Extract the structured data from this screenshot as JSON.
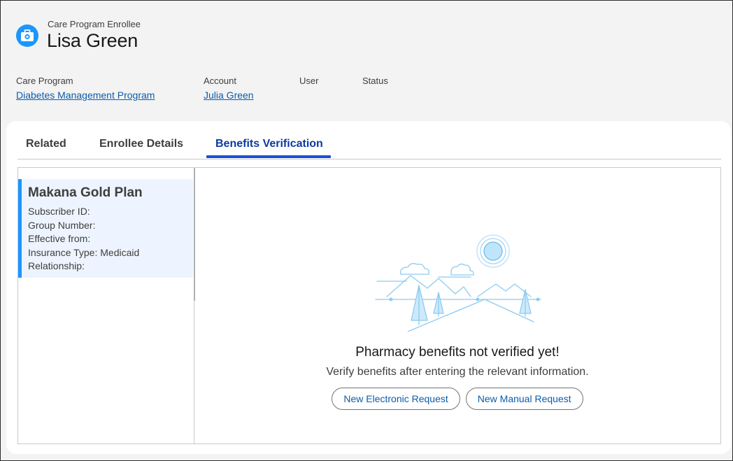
{
  "header": {
    "object_type": "Care Program Enrollee",
    "record_name": "Lisa Green",
    "icon": "briefcase-medical-icon",
    "icon_color": "#1b96ff"
  },
  "highlights": [
    {
      "label": "Care Program",
      "value": "Diabetes Management Program"
    },
    {
      "label": "Account",
      "value": "Julia Green"
    },
    {
      "label": "User",
      "value": ""
    },
    {
      "label": "Status",
      "value": ""
    }
  ],
  "tabs": [
    {
      "label": "Related",
      "active": false
    },
    {
      "label": "Enrollee Details",
      "active": false
    },
    {
      "label": "Benefits Verification",
      "active": true
    }
  ],
  "plan": {
    "name": "Makana Gold Plan",
    "fields": [
      "Subscriber ID:",
      "Group Number:",
      "Effective from:",
      "Insurance Type: Medicaid",
      "Relationship:"
    ]
  },
  "empty_state": {
    "illustration": "mountain-landscape-icon",
    "title": "Pharmacy benefits not verified yet!",
    "subtitle": "Verify benefits after entering the relevant information.",
    "buttons": [
      "New Electronic Request",
      "New Manual Request"
    ]
  },
  "colors": {
    "accent": "#1b96ff",
    "link": "#0b5cab",
    "active_tab": "#0b3aa3"
  }
}
